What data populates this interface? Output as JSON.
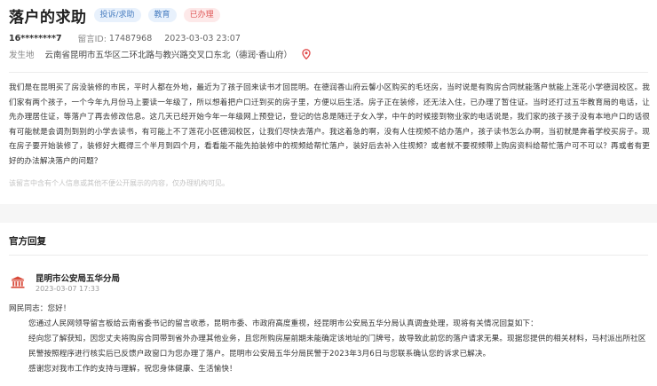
{
  "header": {
    "title": "落户的求助",
    "tags": [
      "投诉/求助",
      "教育",
      "已办理"
    ]
  },
  "meta": {
    "user": "16********7",
    "message_id_label": "留言ID:",
    "message_id": "17487968",
    "datetime": "2023-03-03 23:07"
  },
  "location": {
    "label": "发生地",
    "address": "云南省昆明市五华区二环北路与教兴路交叉口东北（德润·香山府）"
  },
  "message": {
    "body": "我们是在昆明买了房没装修的市民，平时人都在外地，最近为了孩子回来读书才回昆明。在德润香山府云馨小区购买的毛坯房，当时说是有购房合同就能落户就能上莲花小学德润校区。我们家有两个孩子，一个今年九月份马上要读一年级了，所以想着把户口迁到买的房子里，方便以后生活。房子正在装修，还无法入住，已办理了暂住证。当时还打过五华教育局的电话，让先办理居住证，等落户了再去修改信息。这几天已经开始今年一年级网上预登记，登记的信息是随迁子女入学，中午的时候接到物业家的电话说是，我们家的孩子孩子没有本地户口的话很有可能就是会调剂到别的小学去读书，有可能上不了莲花小区德润校区，让我们尽快去落户。我这着急的啊，没有人住视频不给办落户，孩子读书怎么办啊，当初就是奔着学校买房子。现在房子要开始装修了，装修好大概得三个半月到四个月，看看能不能先拍装修中的视频给帮忙落户，装好后去补入住视频？或者就不要视频带上购房资料给帮忙落户可不可以？再或者有更好的办法解决落户的问题？",
    "notice": "该留言中含有个人信息或其他不便公开展示的内容，仅办理机构可见。"
  },
  "official": {
    "heading": "官方回复",
    "org_name": "昆明市公安局五华分局",
    "date": "2023-03-07 17:33",
    "greeting": "网民同志：您好！",
    "paragraphs": [
      "您通过人民网领导留言板给云南省委书记的留言收悉，昆明市委、市政府高度重视，经昆明市公安局五华分局认真调查处理，现将有关情况回复如下：",
      "经向您了解获知，因您丈夫将购房合同带到省外办理其他业务，且您所购房屋前期未能确定该地址的门牌号，故导致此前您的落户请求无果。现据您提供的相关材料，马村派出所社区民警按照程序进行核实后已反馈户政窗口为您办理了落户。昆明市公安局五华分局民警于2023年3月6日与您联系确认您的诉求已解决。",
      "感谢您对我市工作的支持与理解，祝您身体健康、生活愉快！"
    ]
  },
  "colors": {
    "tag_blue_bg": "#e8f1fc",
    "tag_blue_text": "#4a7fc1",
    "tag_red_bg": "#fde9e9",
    "tag_red_text": "#e05a5a",
    "location_pin": "#e04848",
    "gov_icon": "#d84a3a"
  },
  "icons": {
    "location": "location-pin-icon",
    "government": "government-building-icon"
  }
}
